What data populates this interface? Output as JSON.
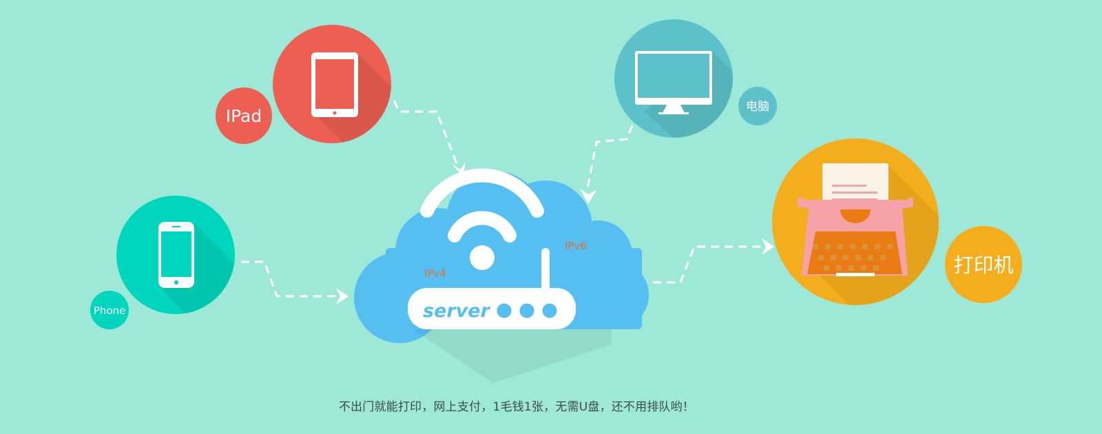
{
  "devices": {
    "ipad": {
      "label": "IPad",
      "color": "#ec5f52",
      "icon": "tablet-icon"
    },
    "phone": {
      "label": "Phone",
      "color": "#00d6bd",
      "icon": "smartphone-icon"
    },
    "computer": {
      "label": "电脑",
      "color": "#5cc1c9",
      "icon": "monitor-icon"
    },
    "printer": {
      "label": "打印机",
      "color": "#f4ad1d",
      "icon": "typewriter-icon"
    }
  },
  "server": {
    "label": "server",
    "ipv4_label": "IPv4",
    "ipv6_label": "IPv6",
    "cloud_color": "#56bff2",
    "icon": "wifi-router-icon"
  },
  "caption": "不出门就能打印，网上支付，1毛钱1张，无需U盘，还不用排队哟！"
}
